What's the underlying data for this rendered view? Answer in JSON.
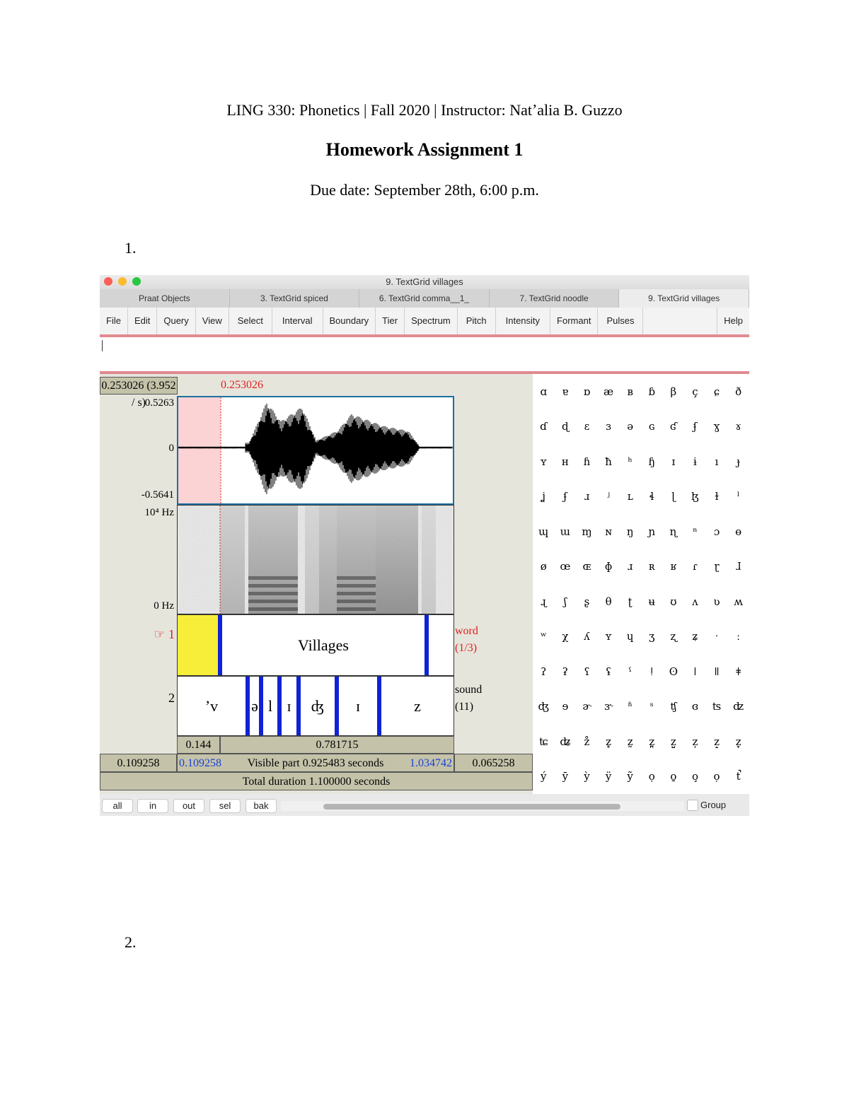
{
  "document": {
    "course_line": "LING 330: Phonetics | Fall 2020 | Instructor: Natʼalia B. Guzzo",
    "title": "Homework Assignment 1",
    "due_date": "Due date: September 28th, 6:00 p.m.",
    "questions": [
      "1.",
      "2."
    ]
  },
  "window": {
    "title": "9. TextGrid villages",
    "tabs": [
      {
        "label": "Praat Objects",
        "active": false
      },
      {
        "label": "3. TextGrid spiced",
        "active": false
      },
      {
        "label": "6. TextGrid comma__1_",
        "active": false
      },
      {
        "label": "7. TextGrid noodle",
        "active": false
      },
      {
        "label": "9. TextGrid villages",
        "active": true
      }
    ],
    "menus": [
      "File",
      "Edit",
      "Query",
      "View",
      "Select",
      "Interval",
      "Boundary",
      "Tier",
      "Spectrum",
      "Pitch",
      "Intensity",
      "Formant",
      "Pulses",
      "",
      "Help"
    ]
  },
  "editor": {
    "selection_duration": "0.253026 (3.952 / s)",
    "cursor_time": "0.253026",
    "waveform": {
      "max_label": "0.5263",
      "zero_label": "0",
      "min_label": "-0.5641"
    },
    "spectrogram": {
      "top_label": "10⁴ Hz",
      "bottom_label": "0 Hz"
    },
    "tiers": [
      {
        "number": "☞ 1",
        "name": "word",
        "count": "(1/3)",
        "segments": [
          "",
          "Villages",
          ""
        ]
      },
      {
        "number": "2",
        "name": "sound",
        "count": "(11)",
        "segments": [
          "’v",
          "ə",
          "l",
          "ɪ",
          "ʤ",
          "ɪ",
          "z"
        ]
      }
    ],
    "interval_durations": {
      "left": "0.144",
      "right": "0.781715"
    },
    "visible_row": {
      "left_outside": "0.109258",
      "start": "0.109258",
      "label": "Visible part 0.925483 seconds",
      "end": "1.034742",
      "right_outside": "0.065258"
    },
    "total_duration": "Total duration 1.100000 seconds"
  },
  "ipa_symbols": [
    [
      "ɑ",
      "ɐ",
      "ɒ",
      "æ",
      "ʙ",
      "ɓ",
      "β",
      "ç",
      "ɕ",
      "ð"
    ],
    [
      "ɗ",
      "ɖ",
      "ɛ",
      "ɜ",
      "ə",
      "ɢ",
      "ʛ",
      "ʄ",
      "ɣ",
      "ɤ"
    ],
    [
      "ʏ",
      "ʜ",
      "ɦ",
      "ħ",
      "ʰ",
      "ɧ",
      "ɪ",
      "ɨ",
      "ı",
      "ɟ"
    ],
    [
      "ʝ",
      "ʄ",
      "ɹ",
      "ʲ",
      "ʟ",
      "ɬ",
      "ɭ",
      "ɮ",
      "ɫ",
      "ˡ"
    ],
    [
      "ɰ",
      "ɯ",
      "ɱ",
      "ɴ",
      "ŋ",
      "ɲ",
      "ɳ",
      "ⁿ",
      "ɔ",
      "ɵ"
    ],
    [
      "ø",
      "œ",
      "ɶ",
      "ɸ",
      "ɹ",
      "ʀ",
      "ʁ",
      "ɾ",
      "ɽ",
      "ɺ"
    ],
    [
      "ɻ",
      "ʃ",
      "ʂ",
      "θ",
      "ʈ",
      "ʉ",
      "ʊ",
      "ʌ",
      "ʋ",
      "ʍ"
    ],
    [
      "ʷ",
      "χ",
      "ʎ",
      "ʏ",
      "ɥ",
      "ʒ",
      "ʐ",
      "ʑ",
      "ˑ",
      "ː"
    ],
    [
      "ʔ",
      "ʡ",
      "ʕ",
      "ʢ",
      "ˤ",
      "ǃ",
      "ʘ",
      "ǀ",
      "ǁ",
      "ǂ"
    ],
    [
      "ʤ",
      "ɘ",
      "ɚ",
      "ɝ",
      "ʱ",
      "ˢ",
      "ʧ",
      "ɞ",
      "ʦ",
      "ʣ"
    ],
    [
      "ʨ",
      "ʥ",
      "z̊",
      "z̥",
      "z̰",
      "z̪",
      "z̺",
      "z̩",
      "z̝",
      "z̞"
    ],
    [
      "ý",
      "ȳ",
      "ỳ",
      "ÿ",
      "ỹ",
      "ọ",
      "o̱",
      "o̧",
      "o̦",
      "t̚"
    ]
  ],
  "bottom_bar": {
    "zoom_buttons": [
      "all",
      "in",
      "out",
      "sel",
      "bak"
    ],
    "group_label": "Group",
    "group_checked": false
  }
}
